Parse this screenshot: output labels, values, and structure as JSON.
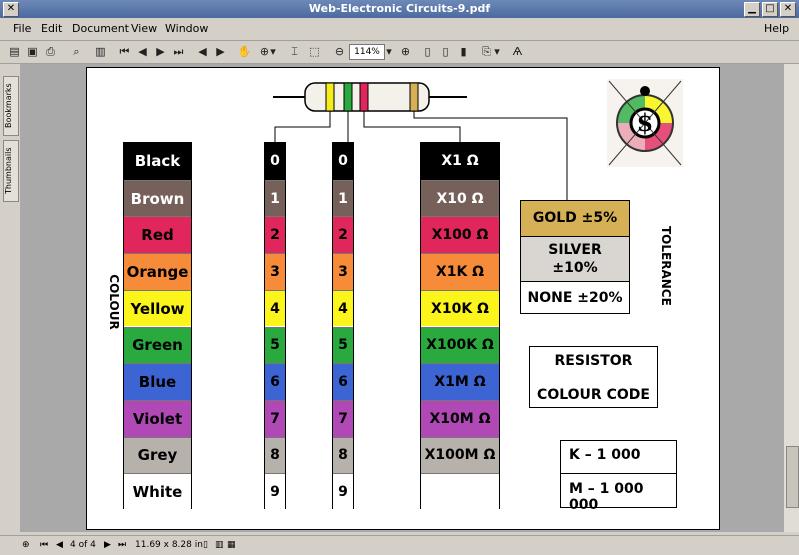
{
  "window": {
    "title": "Web-Electronic Circuits-9.pdf",
    "close": "✕",
    "min": "▁",
    "max": "□"
  },
  "menu": {
    "file": "File",
    "edit": "Edit",
    "document": "Document",
    "view": "View",
    "window": "Window",
    "help": "Help"
  },
  "toolbar": {
    "zoom": "114%"
  },
  "sidebar": {
    "bookmarks": "Bookmarks",
    "thumbnails": "Thumbnails"
  },
  "status": {
    "page": "4 of 4",
    "size": "11.69 x 8.28 in"
  },
  "doc": {
    "colour_label": "COLOUR",
    "tolerance_label": "TOLERANCE",
    "colours": [
      {
        "name": "Black",
        "bg": "#000000",
        "fg": "#ffffff"
      },
      {
        "name": "Brown",
        "bg": "#76615a",
        "fg": "#ffffff"
      },
      {
        "name": "Red",
        "bg": "#e1265b",
        "fg": "#000000"
      },
      {
        "name": "Orange",
        "bg": "#f68c3a",
        "fg": "#000000"
      },
      {
        "name": "Yellow",
        "bg": "#fbf51c",
        "fg": "#000000"
      },
      {
        "name": "Green",
        "bg": "#2aaa3e",
        "fg": "#000000"
      },
      {
        "name": "Blue",
        "bg": "#3c64d2",
        "fg": "#000000"
      },
      {
        "name": "Violet",
        "bg": "#b049b6",
        "fg": "#000000"
      },
      {
        "name": "Grey",
        "bg": "#b6b1aa",
        "fg": "#000000"
      },
      {
        "name": "White",
        "bg": "#ffffff",
        "fg": "#000000"
      }
    ],
    "digits": [
      "0",
      "1",
      "2",
      "3",
      "4",
      "5",
      "6",
      "7",
      "8",
      "9"
    ],
    "multipliers": [
      "X1 Ω",
      "X10 Ω",
      "X100 Ω",
      "X1K Ω",
      "X10K Ω",
      "X100K Ω",
      "X1M Ω",
      "X10M Ω",
      "X100M Ω",
      ""
    ],
    "tolerance": [
      {
        "text": "GOLD ±5%",
        "bg": "#d6b055"
      },
      {
        "text": "SILVER ±10%",
        "bg": "#d9d6d1"
      },
      {
        "text": "NONE ±20%",
        "bg": "#ffffff"
      }
    ],
    "title_box": {
      "line1": "RESISTOR",
      "line2": "COLOUR CODE"
    },
    "units": {
      "k": "K – 1 000",
      "m": "M – 1 000 000"
    },
    "resistor_bands": [
      "#f6ec1c",
      "#2aaa3e",
      "#e1265b",
      "#d6b055"
    ]
  }
}
